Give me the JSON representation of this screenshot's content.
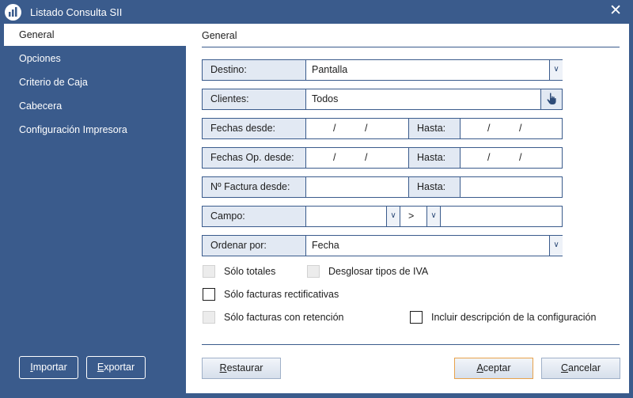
{
  "window": {
    "title": "Listado Consulta SII",
    "close_glyph": "✕",
    "icon": "app-chart-icon"
  },
  "sidebar": {
    "items": [
      {
        "label": "General",
        "active": true
      },
      {
        "label": "Opciones",
        "active": false
      },
      {
        "label": "Criterio de Caja",
        "active": false
      },
      {
        "label": "Cabecera",
        "active": false
      },
      {
        "label": "Configuración Impresora",
        "active": false
      }
    ],
    "buttons": {
      "importar": {
        "first": "I",
        "rest": "mportar"
      },
      "exportar": {
        "first": "E",
        "rest": "xportar"
      }
    }
  },
  "panel": {
    "title": "General",
    "destino": {
      "label": "Destino:",
      "value": "Pantalla"
    },
    "clientes": {
      "label": "Clientes:",
      "value": "Todos"
    },
    "fechas": {
      "label": "Fechas desde:",
      "hasta_label": "Hasta:",
      "sep": "/"
    },
    "fechas_op": {
      "label": "Fechas Op. desde:",
      "hasta_label": "Hasta:",
      "sep": "/"
    },
    "factura": {
      "label": "Nº Factura desde:",
      "hasta_label": "Hasta:"
    },
    "campo": {
      "label": "Campo:",
      "operator": ">",
      "value": ""
    },
    "ordenar": {
      "label": "Ordenar por:",
      "value": "Fecha"
    },
    "checkboxes": {
      "solo_totales": {
        "label": "Sólo totales",
        "enabled": false,
        "checked": false
      },
      "desglosar": {
        "label": "Desglosar tipos de IVA",
        "enabled": false,
        "checked": false
      },
      "rectificativas": {
        "label": "Sólo facturas rectificativas",
        "enabled": true,
        "checked": false
      },
      "retencion": {
        "label": "Sólo facturas con retención",
        "enabled": false,
        "checked": false
      },
      "incluir": {
        "label": "Incluir descripción de la configuración",
        "enabled": true,
        "checked": false
      }
    },
    "buttons": {
      "restaurar": {
        "first": "R",
        "rest": "estaurar"
      },
      "aceptar": {
        "first": "A",
        "rest": "ceptar"
      },
      "cancelar": {
        "first": "C",
        "rest": "ancelar"
      }
    }
  },
  "colors": {
    "frame": "#3a5b8c",
    "label_bg": "#e2e9f3",
    "primary_border": "#e8a24b"
  }
}
